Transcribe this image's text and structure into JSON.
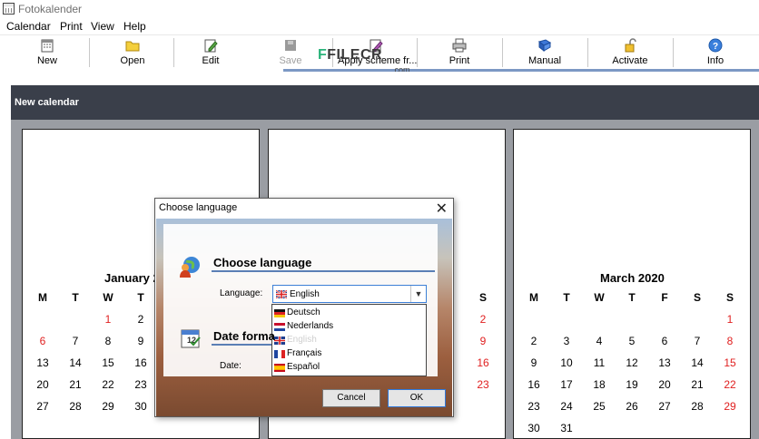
{
  "window": {
    "title": "Fotokalender"
  },
  "menu": [
    "Calendar",
    "Print",
    "View",
    "Help"
  ],
  "toolbar": {
    "new": "New",
    "open": "Open",
    "edit": "Edit",
    "save": "Save",
    "apply": "Apply scheme fr...",
    "print": "Print",
    "manual": "Manual",
    "activate": "Activate",
    "info": "Info"
  },
  "watermark": {
    "brand": "FILECR",
    "sub": ".com"
  },
  "panel": {
    "title": "New calendar"
  },
  "calendar": {
    "weekdays": [
      "M",
      "T",
      "W",
      "T",
      "F",
      "S",
      "S"
    ],
    "january": {
      "title": "January 2"
    },
    "march": {
      "title": "March 2020"
    }
  },
  "dialog": {
    "title": "Choose language",
    "close": "✕",
    "section_language": "Choose language",
    "language_label": "Language:",
    "selected": "English",
    "options": [
      "Deutsch",
      "Nederlands",
      "English",
      "Français",
      "Español"
    ],
    "section_date": "Date forma",
    "date_label": "Date:",
    "cancel": "Cancel",
    "ok": "OK"
  }
}
